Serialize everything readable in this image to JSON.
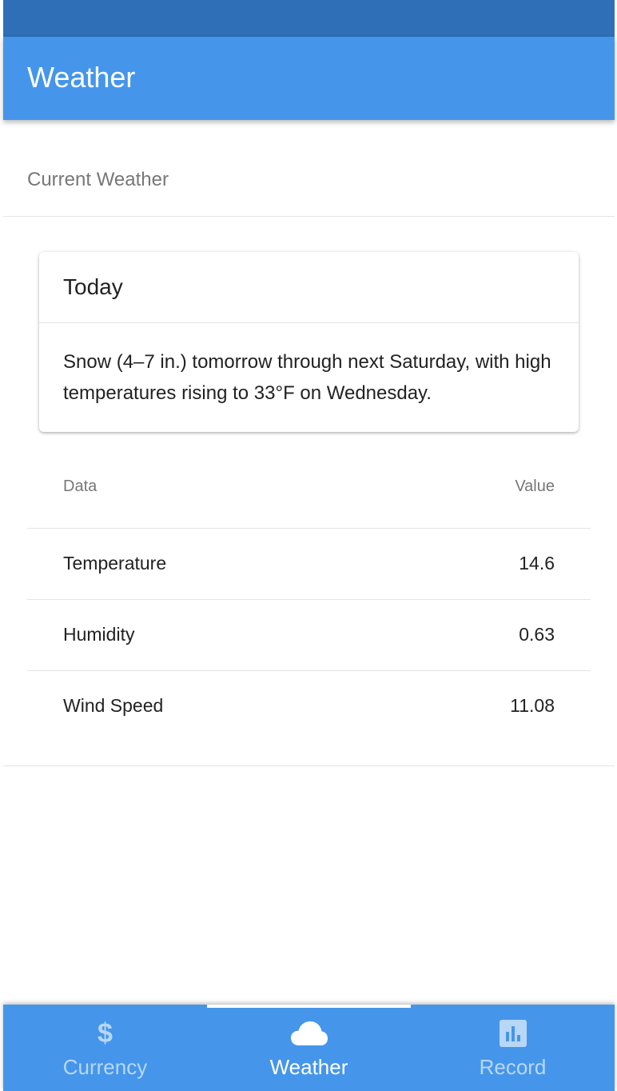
{
  "app_bar": {
    "title": "Weather"
  },
  "section": {
    "title": "Current Weather"
  },
  "card": {
    "title": "Today",
    "summary": "Snow (4–7 in.) tomorrow through next Saturday, with high temperatures rising to 33°F on Wednesday."
  },
  "table": {
    "headers": {
      "data": "Data",
      "value": "Value"
    },
    "rows": [
      {
        "label": "Temperature",
        "value": "14.6"
      },
      {
        "label": "Humidity",
        "value": "0.63"
      },
      {
        "label": "Wind Speed",
        "value": "11.08"
      }
    ]
  },
  "tabs": [
    {
      "label": "Currency",
      "icon": "dollar-icon",
      "active": false
    },
    {
      "label": "Weather",
      "icon": "cloud-icon",
      "active": true
    },
    {
      "label": "Record",
      "icon": "bar-chart-icon",
      "active": false
    }
  ],
  "colors": {
    "status_bar": "#2e6fb8",
    "primary": "#4596ea",
    "divider": "#e4e4e4"
  }
}
